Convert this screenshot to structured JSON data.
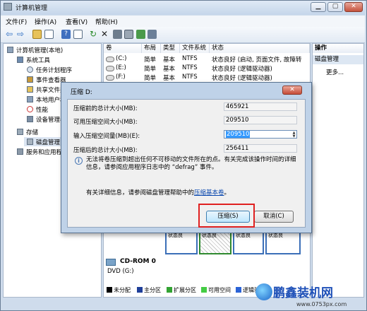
{
  "window": {
    "title": "计算机管理",
    "min": "▁",
    "max": "▢",
    "close": "✕"
  },
  "menu": [
    "文件(F)",
    "操作(A)",
    "查看(V)",
    "帮助(H)"
  ],
  "toolbar": {
    "icons": [
      "back-arrow-icon",
      "forward-arrow-icon",
      "folder-up-icon",
      "show-tree-icon",
      "help-icon",
      "properties-icon",
      "refresh-icon",
      "delete-icon",
      "export-icon",
      "disk-icon",
      "search-icon",
      "settings-icon"
    ],
    "glyphs": [
      "⇦",
      "⇨",
      "",
      "",
      "?",
      "",
      "↻",
      "✕",
      "",
      "",
      "",
      ""
    ]
  },
  "tree": [
    {
      "label": "计算机管理(本地)",
      "level": 0
    },
    {
      "label": "系统工具",
      "level": 1
    },
    {
      "label": "任务计划程序",
      "level": 2
    },
    {
      "label": "事件查看器",
      "level": 2
    },
    {
      "label": "共享文件夹",
      "level": 2
    },
    {
      "label": "本地用户和",
      "level": 2
    },
    {
      "label": "性能",
      "level": 2
    },
    {
      "label": "设备管理器",
      "level": 2
    },
    {
      "label": "存储",
      "level": 1
    },
    {
      "label": "磁盘管理",
      "level": 2
    },
    {
      "label": "服务和应用程",
      "level": 1
    }
  ],
  "list": {
    "columns": [
      "卷",
      "布局",
      "类型",
      "文件系统",
      "状态"
    ],
    "rows": [
      [
        "(C:)",
        "简单",
        "基本",
        "NTFS",
        "状态良好 (启动, 页面文件, 故障转"
      ],
      [
        "(E:)",
        "简单",
        "基本",
        "NTFS",
        "状态良好 (逻辑驱动器)"
      ],
      [
        "(F:)",
        "简单",
        "基本",
        "NTFS",
        "状态良好 (逻辑驱动器)"
      ]
    ]
  },
  "actions": {
    "header": "操作",
    "section": "磁盘管理",
    "more": "更多..."
  },
  "disk_map": {
    "cdrom_label": "CD-ROM 0",
    "cdrom_drive": "DVD (G:)",
    "legend": [
      {
        "label": "未分配",
        "color": "#000000"
      },
      {
        "label": "主分区",
        "color": "#1f3f99"
      },
      {
        "label": "扩展分区",
        "color": "#33a333"
      },
      {
        "label": "可用空间",
        "color": "#44cc44"
      },
      {
        "label": "逻辑驱",
        "color": "#2b63d6"
      }
    ],
    "segment_labels": [
      "状态良",
      "状态良",
      "状态良",
      "状态良"
    ]
  },
  "dialog": {
    "title": "压缩 D:",
    "close": "✕",
    "fields": [
      {
        "label": "压缩前的总计大小(MB):",
        "value": "465921"
      },
      {
        "label": "可用压缩空间大小(MB):",
        "value": "209510"
      },
      {
        "label": "输入压缩空间量(MB)(E):",
        "value": "209510"
      },
      {
        "label": "压缩后的总计大小(MB):",
        "value": "256411"
      }
    ],
    "info": "无法将卷压缩到超出任何不可移动的文件所在的点。有关完成该操作时间的详细信息，请参阅应用程序日志中的 “defrag” 事件。",
    "help_prefix": "有关详细信息，请参阅磁盘管理帮助中的",
    "help_link": "压缩基本卷",
    "help_suffix": "。",
    "ok": "压缩(S)",
    "cancel": "取消(C)"
  },
  "watermark": {
    "brand": "鹏鑫装机网",
    "url": "www.0753px.com"
  }
}
